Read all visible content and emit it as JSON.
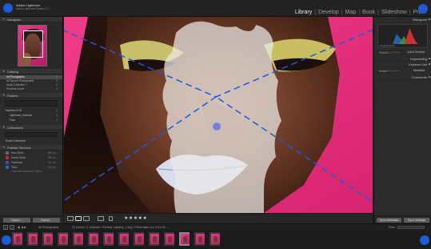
{
  "app": {
    "brand_line1": "Adobe Lightroom",
    "brand_line2": "Adobe Lightroom Classic CC"
  },
  "modules": {
    "items": [
      {
        "label": "Library",
        "active": true
      },
      {
        "label": "Develop",
        "active": false
      },
      {
        "label": "Map",
        "active": false
      },
      {
        "label": "Book",
        "active": false
      },
      {
        "label": "Slideshow",
        "active": false
      },
      {
        "label": "Print",
        "active": false
      }
    ],
    "separator": "|"
  },
  "left_panel": {
    "navigator": {
      "title": "Navigator"
    },
    "catalog": {
      "title": "Catalog",
      "items": [
        {
          "label": "All Photographs",
          "count": "4"
        },
        {
          "label": "All Synced Photographs",
          "count": "0"
        },
        {
          "label": "Quick Collection +",
          "count": "0"
        },
        {
          "label": "Previous Import",
          "count": "4"
        }
      ]
    },
    "folders": {
      "title": "Folders",
      "volume": {
        "label": "Macintosh HD",
        "count": "4"
      },
      "subfolders": [
        {
          "label": "Lightroom_Exercise",
          "count": "4"
        },
        {
          "label": "Face",
          "count": "4"
        }
      ]
    },
    "collections": {
      "title": "Collections",
      "smart": "Smart Collections"
    },
    "publish_services": {
      "title": "Publish Services",
      "services": [
        {
          "label": "Hard Drive",
          "status": "Set Up...",
          "color": "#6b6b6b"
        },
        {
          "label": "Adobe Stock",
          "status": "Set Up...",
          "color": "#c42a2a"
        },
        {
          "label": "Facebook",
          "status": "Set Up...",
          "color": "#3b5998"
        },
        {
          "label": "Flickr",
          "status": "Set Up...",
          "color": "#2a64c4"
        }
      ],
      "find_more": "Find More Services Online..."
    },
    "import_label": "Import...",
    "export_label": "Export..."
  },
  "right_panel": {
    "histogram": {
      "title": "Histogram",
      "original_label": "Original Photo"
    },
    "quick_develop": {
      "title": "Quick Develop",
      "preset": "Custom"
    },
    "keywording": {
      "title": "Keywording"
    },
    "keyword_list": {
      "title": "Keyword List"
    },
    "metadata": {
      "title": "Metadata",
      "preset": "Default"
    },
    "comments": {
      "title": "Comments"
    },
    "sync_label": "Sync Metadata",
    "sync_settings_label": "Sync Settings"
  },
  "toolbar": {
    "rating": "★★★★★"
  },
  "filmstrip": {
    "page_numbers": [
      "1",
      "2"
    ],
    "source": "All Photographs",
    "path": "23 photos / 1 selected / Portrait_Lighting_1.dng / Photo taken on 2011-09-...",
    "filter_label": "Filter:",
    "thumbnail_count": 14,
    "selected_index": 11
  },
  "colors": {
    "backdrop": "#e6307a",
    "overlay_blue": "#1d5bd8",
    "selection_fill": "#e8e6e6"
  }
}
